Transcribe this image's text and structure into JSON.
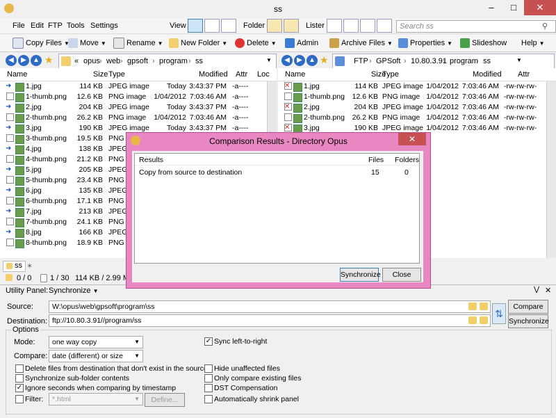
{
  "window": {
    "title": "ss"
  },
  "menu": [
    "File",
    "Edit",
    "FTP",
    "Tools",
    "Settings"
  ],
  "menu_right": {
    "view": "View",
    "folder": "Folder",
    "lister": "Lister"
  },
  "search_placeholder": "Search ss",
  "toolbar": {
    "copy_files": "Copy Files",
    "move": "Move",
    "rename": "Rename",
    "new_folder": "New Folder",
    "delete": "Delete",
    "admin": "Admin",
    "archive_files": "Archive Files",
    "properties": "Properties",
    "slideshow": "Slideshow",
    "help": "Help"
  },
  "left_pane": {
    "path": [
      "«",
      "opus",
      "web",
      "gpsoft",
      "program",
      "ss"
    ],
    "columns": {
      "name": "Name",
      "size": "Size",
      "type": "Type",
      "modified": "Modified",
      "attr": "Attr",
      "loc": "Loc"
    },
    "rows": [
      {
        "name": "1.jpg",
        "size": "114 KB",
        "type": "JPEG image",
        "date": "Today",
        "time": "3:43:37 PM",
        "attr": "-a----",
        "mark": "arrow"
      },
      {
        "name": "1-thumb.png",
        "size": "12.6 KB",
        "type": "PNG image",
        "date": "1/04/2012",
        "time": "7:03:46 AM",
        "attr": "-a----",
        "mark": "box"
      },
      {
        "name": "2.jpg",
        "size": "204 KB",
        "type": "JPEG image",
        "date": "Today",
        "time": "3:43:37 PM",
        "attr": "-a----",
        "mark": "arrow"
      },
      {
        "name": "2-thumb.png",
        "size": "26.2 KB",
        "type": "PNG image",
        "date": "1/04/2012",
        "time": "7:03:46 AM",
        "attr": "-a----",
        "mark": "box"
      },
      {
        "name": "3.jpg",
        "size": "190 KB",
        "type": "JPEG image",
        "date": "Today",
        "time": "3:43:37 PM",
        "attr": "-a----",
        "mark": "arrow"
      },
      {
        "name": "3-thumb.png",
        "size": "19.5 KB",
        "type": "PNG i",
        "date": "",
        "time": "",
        "attr": "",
        "mark": "box"
      },
      {
        "name": "4.jpg",
        "size": "138 KB",
        "type": "JPEG i",
        "date": "",
        "time": "",
        "attr": "",
        "mark": "arrow"
      },
      {
        "name": "4-thumb.png",
        "size": "21.2 KB",
        "type": "PNG i",
        "date": "",
        "time": "",
        "attr": "",
        "mark": "box"
      },
      {
        "name": "5.jpg",
        "size": "205 KB",
        "type": "JPEG i",
        "date": "",
        "time": "",
        "attr": "",
        "mark": "arrow"
      },
      {
        "name": "5-thumb.png",
        "size": "23.4 KB",
        "type": "PNG i",
        "date": "",
        "time": "",
        "attr": "",
        "mark": "box"
      },
      {
        "name": "6.jpg",
        "size": "135 KB",
        "type": "JPEG i",
        "date": "",
        "time": "",
        "attr": "",
        "mark": "arrow"
      },
      {
        "name": "6-thumb.png",
        "size": "17.1 KB",
        "type": "PNG i",
        "date": "",
        "time": "",
        "attr": "",
        "mark": "box"
      },
      {
        "name": "7.jpg",
        "size": "213 KB",
        "type": "JPEG i",
        "date": "",
        "time": "",
        "attr": "",
        "mark": "arrow"
      },
      {
        "name": "7-thumb.png",
        "size": "24.1 KB",
        "type": "PNG i",
        "date": "",
        "time": "",
        "attr": "",
        "mark": "box"
      },
      {
        "name": "8.jpg",
        "size": "166 KB",
        "type": "JPEG i",
        "date": "",
        "time": "",
        "attr": "",
        "mark": "arrow"
      },
      {
        "name": "8-thumb.png",
        "size": "18.9 KB",
        "type": "PNG i",
        "date": "",
        "time": "",
        "attr": "",
        "mark": "box"
      }
    ]
  },
  "right_pane": {
    "path": [
      "FTP",
      "GPSoft",
      "10.80.3.91",
      "program",
      "ss"
    ],
    "columns": {
      "name": "Name",
      "size": "Size",
      "type": "Type",
      "modified": "Modified",
      "attr": "Attr"
    },
    "rows": [
      {
        "name": "1.jpg",
        "size": "114 KB",
        "type": "JPEG image",
        "date": "1/04/2012",
        "time": "7:03:46 AM",
        "attr": "-rw-rw-rw-",
        "mark": "x"
      },
      {
        "name": "1-thumb.png",
        "size": "12.6 KB",
        "type": "PNG image",
        "date": "1/04/2012",
        "time": "7:03:46 AM",
        "attr": "-rw-rw-rw-",
        "mark": "box"
      },
      {
        "name": "2.jpg",
        "size": "204 KB",
        "type": "JPEG image",
        "date": "1/04/2012",
        "time": "7:03:46 AM",
        "attr": "-rw-rw-rw-",
        "mark": "x"
      },
      {
        "name": "2-thumb.png",
        "size": "26.2 KB",
        "type": "PNG image",
        "date": "1/04/2012",
        "time": "7:03:46 AM",
        "attr": "-rw-rw-rw-",
        "mark": "box"
      },
      {
        "name": "3.jpg",
        "size": "190 KB",
        "type": "JPEG image",
        "date": "1/04/2012",
        "time": "7:03:46 AM",
        "attr": "-rw-rw-rw-",
        "mark": "x"
      }
    ]
  },
  "tab": {
    "label": "ss"
  },
  "status": {
    "folders": "0 / 0",
    "files": "1 / 30",
    "size": "114 KB / 2.99 MB"
  },
  "utility": {
    "label": "Utility Panel:",
    "mode": "Synchronize",
    "source_label": "Source:",
    "source": "W:\\opus\\web\\gpsoft\\program\\ss",
    "dest_label": "Destination:",
    "dest": "ftp://10.80.3.91//program/ss",
    "compare_btn": "Compare",
    "sync_btn": "Synchronize",
    "options": "Options",
    "mode_label": "Mode:",
    "mode_value": "one way copy",
    "compare_label": "Compare:",
    "compare_value": "date (different) or size",
    "sync_lr": "Sync left-to-right",
    "delete_files": "Delete files from destination that don't exist in the source",
    "sync_sub": "Synchronize sub-folder contents",
    "ignore_seconds": "Ignore seconds when comparing by timestamp",
    "filter_label": "Filter:",
    "filter_placeholder": "*.html",
    "define": "Define...",
    "hide_unaffected": "Hide unaffected files",
    "only_existing": "Only compare existing files",
    "dst": "DST Compensation",
    "auto_shrink": "Automatically shrink panel"
  },
  "dialog": {
    "title": "Comparison Results - Directory Opus",
    "col_results": "Results",
    "col_files": "Files",
    "col_folders": "Folders",
    "row": {
      "text": "Copy from source to destination",
      "files": "15",
      "folders": "0"
    },
    "sync_btn": "Synchronize",
    "close_btn": "Close"
  }
}
